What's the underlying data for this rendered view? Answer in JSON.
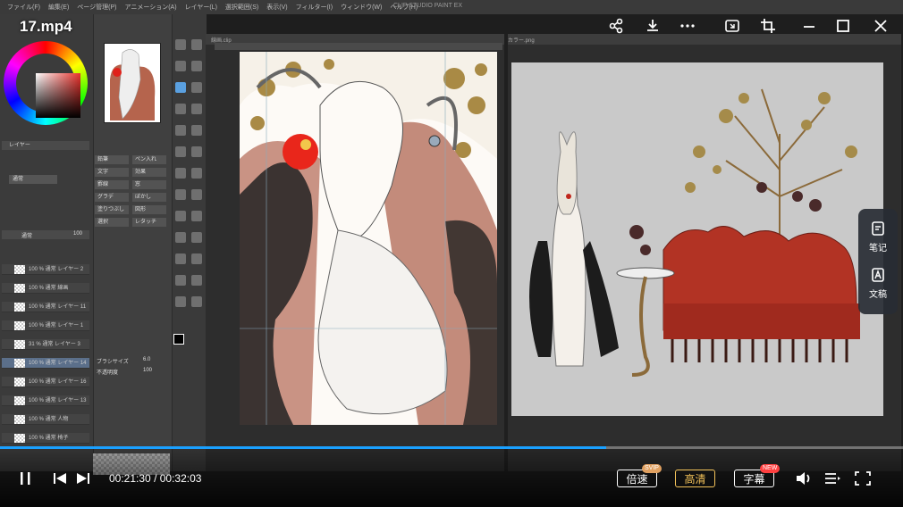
{
  "player": {
    "title": "17.mp4",
    "current_time": "00:21:30",
    "separator": "/",
    "total_time": "00:32:03",
    "progress": 0.671,
    "speed_label": "倍速",
    "speed_badge": "SVIP",
    "quality_label": "高清",
    "subtitle_label": "字幕",
    "subtitle_badge": "NEW",
    "side_panel": [
      {
        "icon": "note-icon",
        "label": "笔记"
      },
      {
        "icon": "document-ai-icon",
        "label": "文稿"
      }
    ],
    "top_icons": [
      "share-icon",
      "download-icon",
      "more-icon",
      "pip-icon",
      "crop-icon",
      "minimize-icon",
      "maximize-icon",
      "close-icon"
    ],
    "colors": {
      "accent": "#1aa0ff",
      "svip_badge": "#e0a060",
      "new_badge": "#ff4040"
    }
  },
  "app": {
    "menu": [
      "ファイル(F)",
      "編集(E)",
      "ページ管理(P)",
      "アニメーション(A)",
      "レイヤー(L)",
      "選択範囲(S)",
      "表示(V)",
      "フィルター(I)",
      "ウィンドウ(W)",
      "ヘルプ(H)"
    ],
    "title_center": "CLIP STUDIO PAINT EX",
    "layer_panel_label": "レイヤー",
    "layers": [
      "100 % 通常 レイヤー 2",
      "100 % 通常 線画",
      "100 % 通常 レイヤー 11",
      "100 % 通常 レイヤー 1",
      "31 % 通常 レイヤー 3",
      "100 % 通常 レイヤー 14",
      "100 % 通常 レイヤー 16",
      "100 % 通常 レイヤー 13",
      "100 % 通常 人物",
      "100 % 通常 椅子"
    ],
    "blend_mode": "通常",
    "opacity": "100",
    "tool_buttons": [
      "鉛筆",
      "ペン入れ",
      "文字",
      "効果",
      "罫線",
      "窓",
      "グラデ",
      "ぼかし",
      "塗りつぶし",
      "図形",
      "選択",
      "レタッチ"
    ],
    "brush_size_label": "ブラシサイズ",
    "brush_size_value": "6.0",
    "opacity_label": "不透明度",
    "opacity_value": "100",
    "canvas_tab": "線画.clip",
    "ref_tab": "カラー.png"
  }
}
